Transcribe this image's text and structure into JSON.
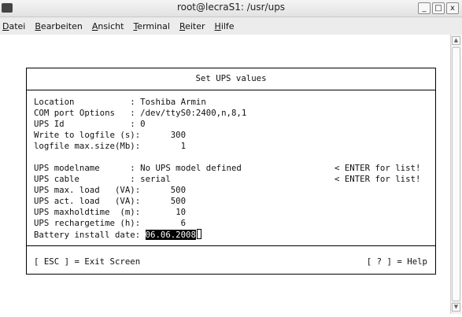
{
  "window": {
    "title": "root@lecraS1: /usr/ups",
    "buttons": [
      "_",
      "□",
      "x"
    ]
  },
  "menu": [
    {
      "underline": "D",
      "rest": "atei"
    },
    {
      "underline": "B",
      "rest": "earbeiten"
    },
    {
      "underline": "A",
      "rest": "nsicht"
    },
    {
      "underline": "T",
      "rest": "erminal"
    },
    {
      "underline": "R",
      "rest": "eiter"
    },
    {
      "underline": "H",
      "rest": "ilfe"
    }
  ],
  "dialog": {
    "title": "Set UPS values",
    "fields": [
      {
        "label": "Location           ",
        "sep": ": ",
        "value": "Toshiba Armin"
      },
      {
        "label": "COM port Options   ",
        "sep": ": ",
        "value": "/dev/ttyS0:2400,n,8,1"
      },
      {
        "label": "UPS Id             ",
        "sep": ": ",
        "value": "0"
      },
      {
        "label": "Write to logfile (s)",
        "sep": ":      ",
        "value": "300"
      },
      {
        "label": "logfile max.size(Mb)",
        "sep": ":        ",
        "value": "1"
      },
      {
        "label": "UPS modelname      ",
        "sep": ": ",
        "value": "No UPS model defined",
        "hint": "< ENTER for list!"
      },
      {
        "label": "UPS cable          ",
        "sep": ": ",
        "value": "serial",
        "hint": "< ENTER for list!"
      },
      {
        "label": "UPS max. load   (VA)",
        "sep": ":      ",
        "value": "500"
      },
      {
        "label": "UPS act. load   (VA)",
        "sep": ":      ",
        "value": "500"
      },
      {
        "label": "UPS maxholdtime  (m)",
        "sep": ":       ",
        "value": "10"
      },
      {
        "label": "UPS rechargetime (h)",
        "sep": ":        ",
        "value": "6"
      },
      {
        "label": "Battery install date",
        "sep": ": ",
        "value": "06.06.2008"
      }
    ],
    "footer_left": "[ ESC ] = Exit Screen",
    "footer_right": "[ ? ] = Help"
  }
}
